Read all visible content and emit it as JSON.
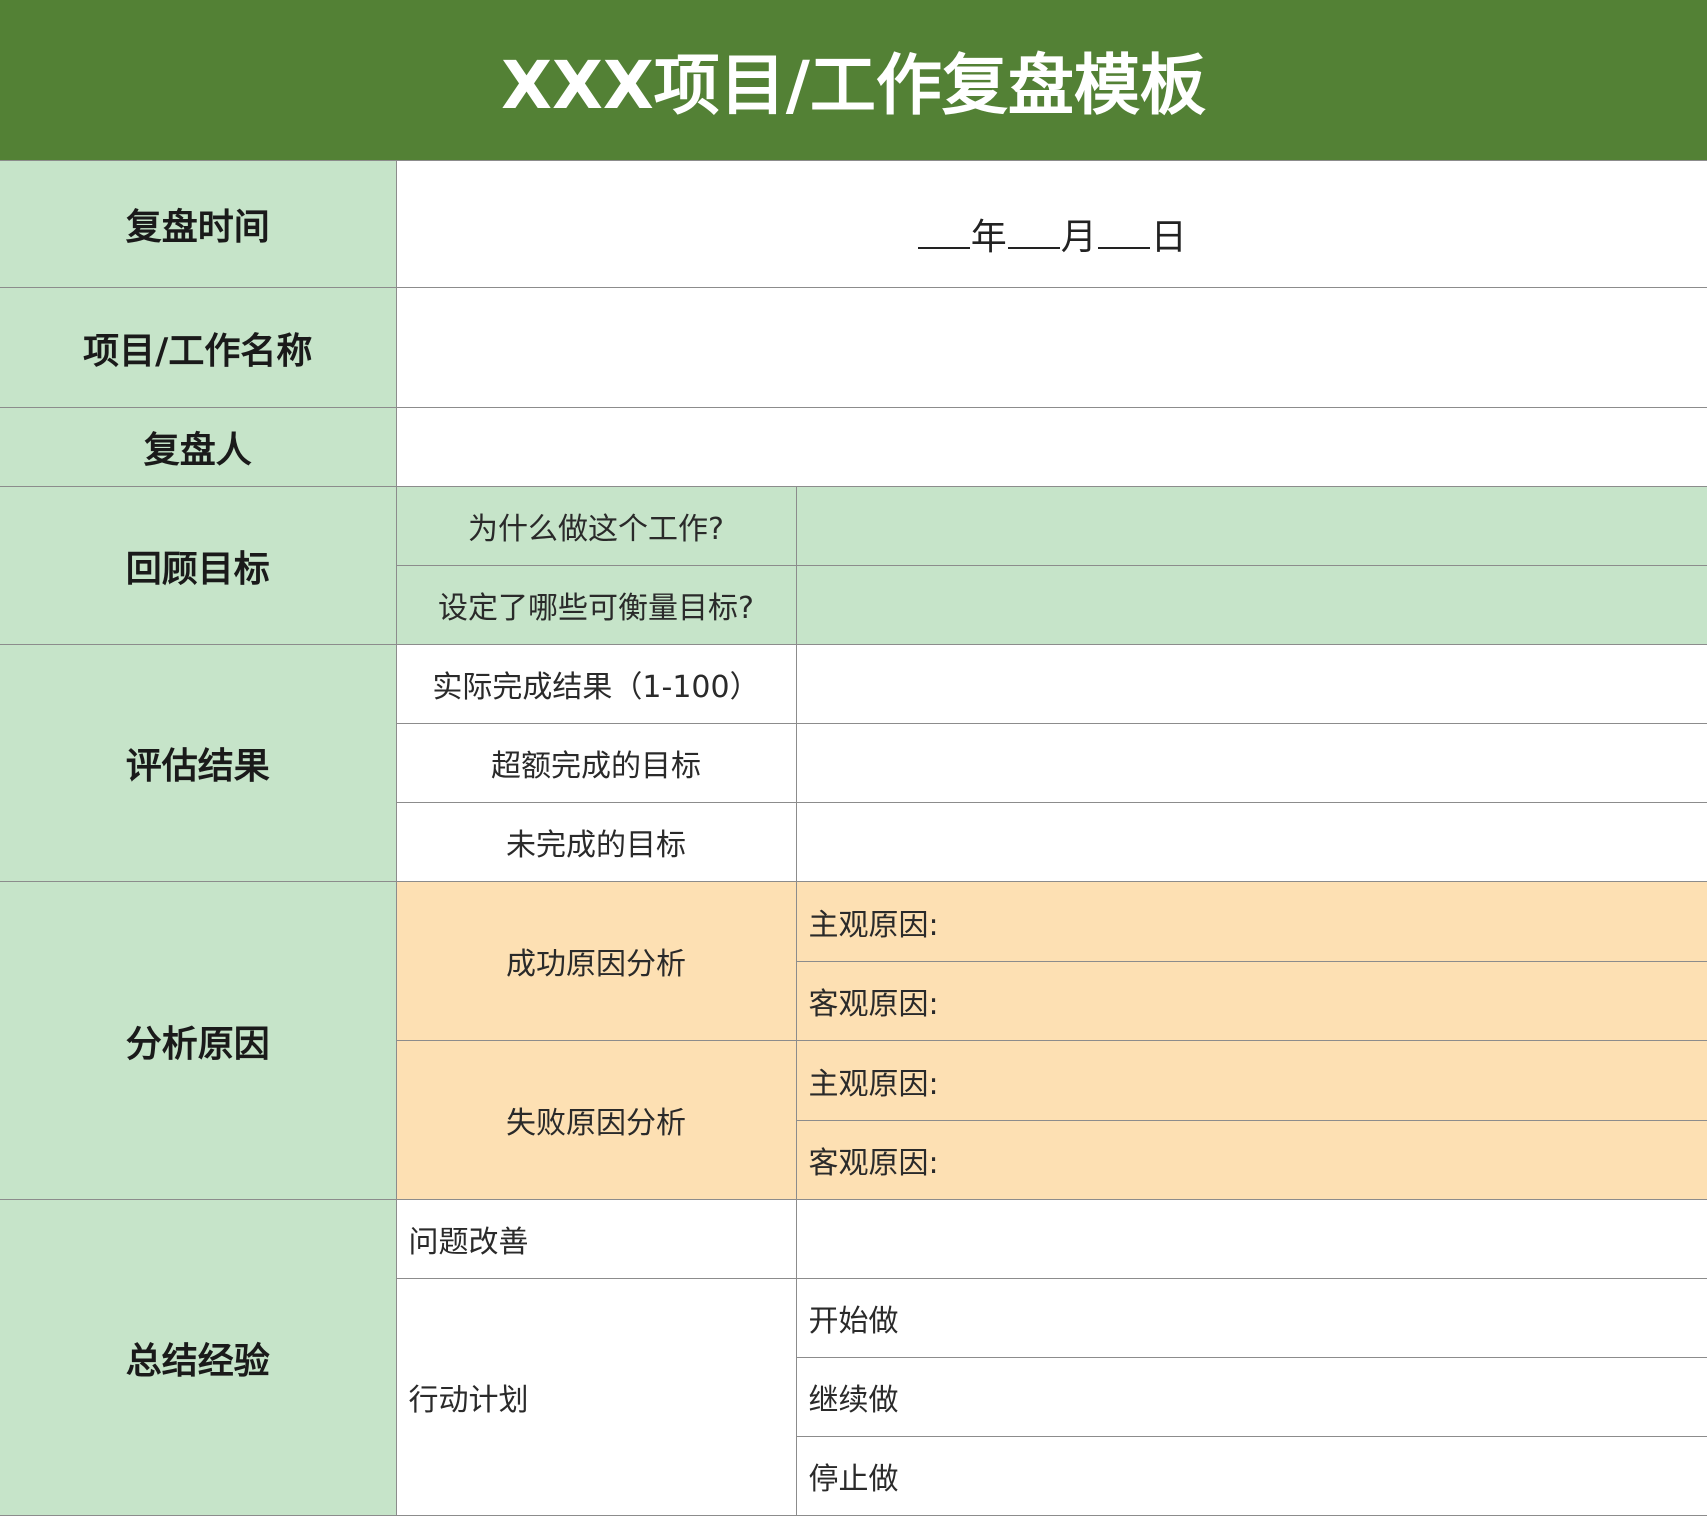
{
  "title": "XXX项目/工作复盘模板",
  "date_row": {
    "label": "复盘时间",
    "year": "年",
    "month": "月",
    "day": "日"
  },
  "name_row": {
    "label": "项目/工作名称"
  },
  "reviewer_row": {
    "label": "复盘人"
  },
  "review_goals": {
    "label": "回顾目标",
    "items": [
      "为什么做这个工作?",
      "设定了哪些可衡量目标?"
    ]
  },
  "evaluate": {
    "label": "评估结果",
    "items": [
      "实际完成结果（1-100）",
      "超额完成的目标",
      "未完成的目标"
    ]
  },
  "analyze": {
    "label": "分析原因",
    "success": {
      "label": "成功原因分析",
      "subjective": "主观原因:",
      "objective": "客观原因:"
    },
    "failure": {
      "label": "失败原因分析",
      "subjective": "主观原因:",
      "objective": "客观原因:"
    }
  },
  "summary": {
    "label": "总结经验",
    "improve": "问题改善",
    "action_plan": "行动计划",
    "actions": [
      "开始做",
      "继续做",
      "停止做"
    ]
  }
}
